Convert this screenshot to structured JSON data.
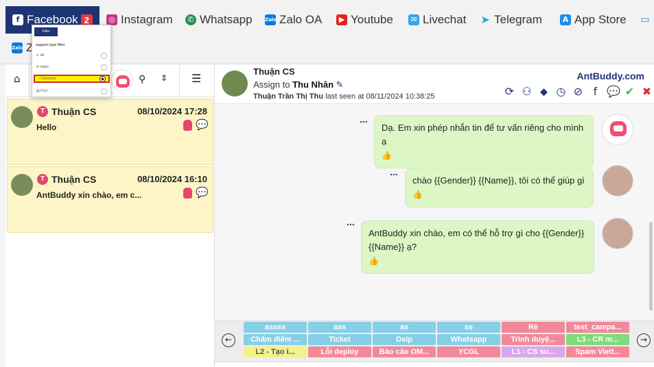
{
  "nav": {
    "tabs": [
      {
        "label": "Facebook",
        "icon": "facebook-icon",
        "active": true,
        "badge": "2"
      },
      {
        "label": "Instagram",
        "icon": "instagram-icon"
      },
      {
        "label": "Whatsapp",
        "icon": "whatsapp-icon"
      },
      {
        "label": "Zalo OA",
        "icon": "zalo-icon"
      },
      {
        "label": "Youtube",
        "icon": "youtube-icon"
      },
      {
        "label": "Livechat",
        "icon": "livechat-icon"
      },
      {
        "label": "Telegram",
        "icon": "telegram-icon"
      },
      {
        "label": "App Store",
        "icon": "app-store-icon"
      }
    ],
    "second_row_label": "Z"
  },
  "filter_popup": {
    "button": "Filter",
    "title": "support type filter",
    "options": [
      {
        "label": "All",
        "selected": false
      },
      {
        "label": "Inbox",
        "selected": false
      },
      {
        "label": "Comment",
        "selected": true
      },
      {
        "label": "Post",
        "selected": false
      }
    ]
  },
  "conversations": [
    {
      "name": "Thuận CS",
      "badge": "T",
      "time": "08/10/2024 17:28",
      "message": "Hello"
    },
    {
      "name": "Thuận CS",
      "badge": "T",
      "time": "08/10/2024 16:10",
      "message": "AntBuddy xin chào, em c..."
    }
  ],
  "chat": {
    "contact_name": "Thuận CS",
    "assign_prefix": "Assign to",
    "assignee": "Thu Nhân",
    "seen_name": "Thuận Trần Thị Thu",
    "seen_text": "last seen at 08/11/2024 10:38:25",
    "brand": "AntBuddy.com",
    "messages": [
      {
        "text": "Dạ. Em xin phép nhắn tin để tư vấn riêng cho mình ạ"
      },
      {
        "text": "chào {{Gender}} {{Name}}, tôi có thể giúp gì"
      },
      {
        "text": "AntBuddy xin chào, em có thể hỗ trợ gì cho {{Gender}} {{Name}} ạ?"
      }
    ],
    "message_menu": "...",
    "like_icon": "👍"
  },
  "tags": [
    {
      "label": "assss",
      "color": "#86cfe6"
    },
    {
      "label": "ass",
      "color": "#86cfe6"
    },
    {
      "label": "as",
      "color": "#86cfe6"
    },
    {
      "label": "ss",
      "color": "#86cfe6"
    },
    {
      "label": "Rè",
      "color": "#f2899a"
    },
    {
      "label": "test_campa...",
      "color": "#f2899a"
    },
    {
      "label": "Chấm điểm ...",
      "color": "#86cfe6"
    },
    {
      "label": "Ticket",
      "color": "#86cfe6"
    },
    {
      "label": "Dsip",
      "color": "#86cfe6"
    },
    {
      "label": "Whatsapp",
      "color": "#86cfe6"
    },
    {
      "label": "Trình duyệ...",
      "color": "#f2899a"
    },
    {
      "label": "L3 - CR m...",
      "color": "#7fdc7a"
    },
    {
      "label": "L2 - Tạo i...",
      "color": "#f4f08a"
    },
    {
      "label": "Lỗi deploy",
      "color": "#f2899a"
    },
    {
      "label": "Báo cáo OM...",
      "color": "#f2899a"
    },
    {
      "label": "YCGL",
      "color": "#f2899a"
    },
    {
      "label": "L1 - CS su...",
      "color": "#d9a8ec"
    },
    {
      "label": "Spam Viett...",
      "color": "#f2899a"
    }
  ]
}
